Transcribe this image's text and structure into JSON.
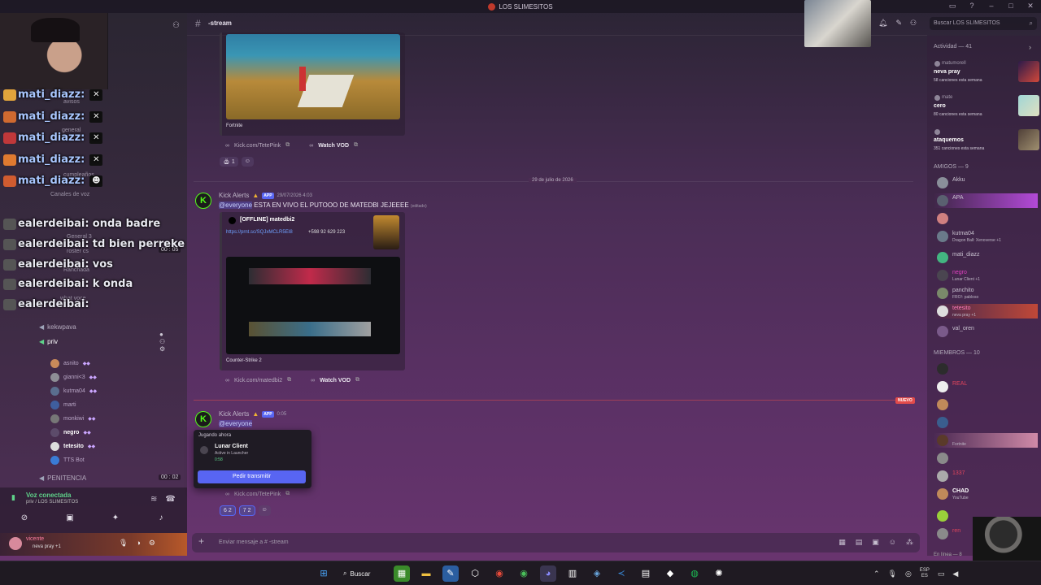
{
  "window": {
    "title": "LOS SLIMESITOS"
  },
  "sidebar": {
    "overlay_chat": [
      {
        "name": "mati_diazz:",
        "text": ""
      },
      {
        "name": "mati_diazz:",
        "text": ""
      },
      {
        "name": "mati_diazz:",
        "text": ""
      },
      {
        "name": "mati_diazz:",
        "text": ""
      },
      {
        "name": "mati_diazz:",
        "text": ""
      },
      {
        "name": "ealerdeibai:",
        "text": "onda badre"
      },
      {
        "name": "ealerdeibai:",
        "text": "td bien perreke"
      },
      {
        "name": "ealerdeibai:",
        "text": "vos"
      },
      {
        "name": "ealerdeibai:",
        "text": "k onda"
      },
      {
        "name": "ealerdeibai:",
        "text": ""
      }
    ],
    "faint_channels": [
      "avisos",
      "general",
      "cumpleaños",
      "Canales de voz",
      "General 3",
      "roster cs",
      "Ranchada",
      "what voce"
    ],
    "timer_1": "00 : 05",
    "channels": {
      "kekwpava": "kekwpava",
      "priv": "priv",
      "penitencia": "PENITENCIA",
      "penitencia_timer": "00 : 02"
    },
    "voice_members": [
      "asnito",
      "gianni<3",
      "kutma04",
      "marti",
      "monkiwi",
      "negro",
      "tetesito",
      "TTS Bot"
    ],
    "voice_panel": {
      "title": "Voz conectada",
      "subtitle": "priv / LOS SLIMESITOS"
    },
    "user": {
      "name": "vicente",
      "status": "neva pray +1"
    }
  },
  "header": {
    "channel": "-stream",
    "search_placeholder": "Buscar LOS SLIMESITOS"
  },
  "messages": {
    "embed1": {
      "game": "Fortnite",
      "link": "Kick.com/TetePink",
      "vod": "Watch VOD",
      "reaction_count": "1"
    },
    "date_divider": "29 de julio de 2026",
    "msg2": {
      "author": "Kick Alerts",
      "app": "APP",
      "time": "29/07/2026 4:03",
      "mention": "@everyone",
      "text": "ESTA EN VIVO EL PUTOOO DE MATEDBI JEJEEEE",
      "edited": "(editado)",
      "embed_title": "[OFFLINE] matedbi2",
      "embed_link": "https://prnt.sc/SQJxMCLR5EI8",
      "embed_phone": "+598 92 629 223",
      "game": "Counter-Strike 2",
      "link": "Kick.com/matedbi2",
      "vod": "Watch VOD"
    },
    "new_badge": "NUEVO",
    "msg3": {
      "author": "Kick Alerts",
      "app": "APP",
      "time": "0:05",
      "mention": "@everyone",
      "link": "Kick.com/TetePink",
      "reactions": [
        {
          "emoji": "6",
          "count": "2"
        },
        {
          "emoji": "7",
          "count": "2"
        }
      ]
    }
  },
  "popup": {
    "title": "Jugando ahora",
    "game": "Lunar Client",
    "status": "Active in Launcher",
    "time": "0:58",
    "button": "Pedir transmitir"
  },
  "composer": {
    "placeholder": "Enviar mensaje a # -stream"
  },
  "right_panel": {
    "activity_header": "Actividad — 41",
    "activities": [
      {
        "name": "matumorell",
        "title": "neva pray",
        "sub": "58 canciones esta semana",
        "color": "#c0383a"
      },
      {
        "name": "mate",
        "title": "cero",
        "sub": "80 canciones esta semana",
        "color": "#6fb6c0"
      },
      {
        "name": "",
        "title": "ataquemos",
        "sub": "351 canciones esta semana",
        "color": "#7b5a4b"
      }
    ],
    "friends_header": "AMIGOS — 9",
    "friends": [
      {
        "name": "Akku",
        "status": "",
        "cls": ""
      },
      {
        "name": "APA",
        "status": "",
        "cls": ""
      },
      {
        "name": "",
        "status": "",
        "cls": "pink"
      },
      {
        "name": "kutma04",
        "status": "Dragon Ball: Xenoverse +1",
        "cls": ""
      },
      {
        "name": "mati_diazz",
        "status": "",
        "cls": ""
      },
      {
        "name": "negro",
        "status": "Lunar Client +1",
        "cls": "mag"
      },
      {
        "name": "panchito",
        "status": "FRO!: pabloso",
        "cls": ""
      },
      {
        "name": "tetesito",
        "status": "neva pray +1",
        "cls": "pink"
      },
      {
        "name": "val_oren",
        "status": "",
        "cls": ""
      }
    ],
    "members_header": "MIEMBROS — 10",
    "members": [
      {
        "name": "",
        "status": "",
        "cls": "red"
      },
      {
        "name": "REAL",
        "status": "",
        "cls": "red"
      },
      {
        "name": "",
        "status": "",
        "cls": "red"
      },
      {
        "name": "",
        "status": "",
        "cls": "red"
      },
      {
        "name": "",
        "status": "Fortnite",
        "cls": "red"
      },
      {
        "name": "",
        "status": "",
        "cls": "red"
      },
      {
        "name": "1337",
        "status": "",
        "cls": "red"
      },
      {
        "name": "CHAD",
        "status": "YouTube",
        "cls": "bold"
      },
      {
        "name": "",
        "status": "",
        "cls": "red"
      },
      {
        "name": "ren",
        "status": "",
        "cls": "red"
      }
    ],
    "online_count": "En línea — 8"
  },
  "taskbar": {
    "search": "Buscar",
    "lang_top": "ESP",
    "lang_bottom": "ES"
  }
}
